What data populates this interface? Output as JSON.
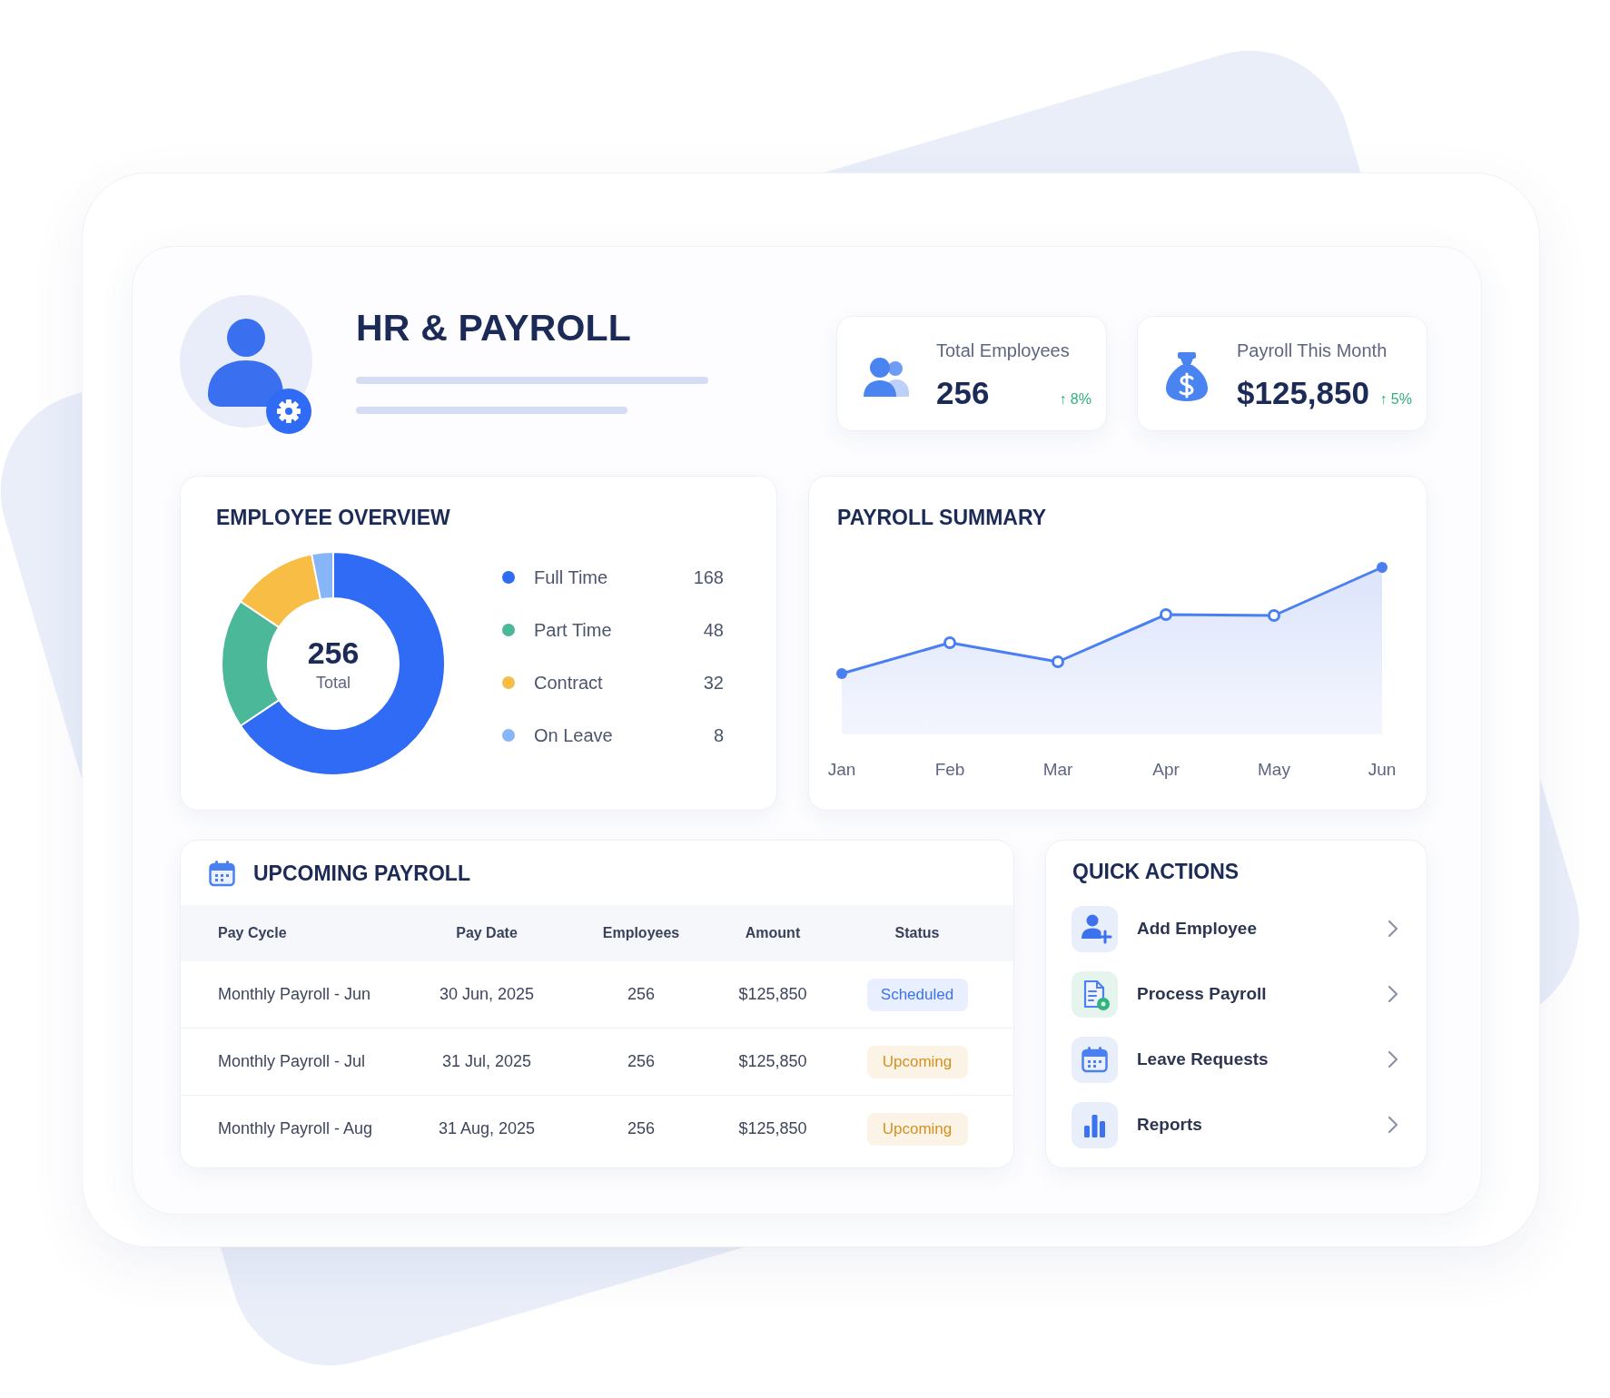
{
  "header": {
    "title": "HR & PAYROLL"
  },
  "stats": [
    {
      "label": "Total Employees",
      "value": "256",
      "change": "↑ 8%"
    },
    {
      "label": "Payroll This Month",
      "value": "$125,850",
      "change": "↑ 5%"
    }
  ],
  "employee_overview": {
    "title": "EMPLOYEE OVERVIEW",
    "total_value": "256",
    "total_label": "Total",
    "legend": [
      {
        "label": "Full Time",
        "count": "168",
        "color": "#2f6bf5"
      },
      {
        "label": "Part Time",
        "count": "48",
        "color": "#4cb89a"
      },
      {
        "label": "Contract",
        "count": "32",
        "color": "#f7bd45"
      },
      {
        "label": "On Leave",
        "count": "8",
        "color": "#86b6f8"
      }
    ],
    "chart_data": {
      "type": "donut",
      "values": [
        65.6,
        18.8,
        12.5,
        3.1
      ]
    }
  },
  "payroll_summary": {
    "title": "PAYROLL SUMMARY",
    "x_labels": [
      "Jan",
      "Feb",
      "Mar",
      "Apr",
      "May",
      "Jun"
    ]
  },
  "upcoming_payroll": {
    "title": "UPCOMING PAYROLL",
    "columns": [
      "Pay Cycle",
      "Pay Date",
      "Employees",
      "Amount",
      "Status"
    ],
    "rows": [
      {
        "cells": [
          "Monthly Payroll - Jun",
          "30 Jun, 2025",
          "256",
          "$125,850"
        ],
        "status": {
          "label": "Scheduled",
          "color": "#3b72f2"
        }
      },
      {
        "cells": [
          "Monthly Payroll - Jul",
          "31 Jul, 2025",
          "256",
          "$125,850"
        ],
        "status": {
          "label": "Upcoming",
          "color": "#d4911f"
        }
      },
      {
        "cells": [
          "Monthly Payroll - Aug",
          "31 Aug, 2025",
          "256",
          "$125,850"
        ],
        "status": {
          "label": "Upcoming",
          "color": "#d4911f"
        }
      }
    ]
  },
  "quick_actions": {
    "title": "QUICK ACTIONS",
    "items": [
      {
        "label": "Add Employee"
      },
      {
        "label": "Process Payroll"
      },
      {
        "label": "Leave Requests"
      },
      {
        "label": "Reports"
      }
    ]
  }
}
